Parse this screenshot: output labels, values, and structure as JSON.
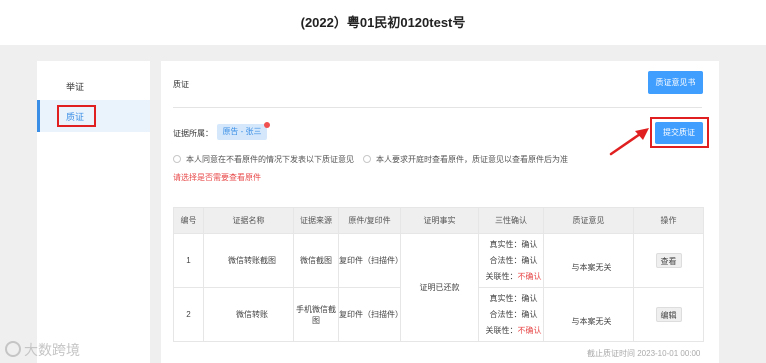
{
  "header": {
    "case_title": "(2022）粤01民初0120test号"
  },
  "sidebar": {
    "items": [
      {
        "label": "举证"
      },
      {
        "label": "质证"
      }
    ]
  },
  "main": {
    "section_title": "质证",
    "opinion_button": "质证意见书",
    "evidence_belong_label": "证据所属：",
    "evidence_belong_tag": "原告 - 张三",
    "submit_button": "提交质证",
    "radio_options": [
      "本人同意在不看原件的情况下发表以下质证意见",
      "本人要求开庭时查看原件，质证意见以查看原件后为准"
    ],
    "warning": "请选择是否需要查看原件",
    "table": {
      "headers": [
        "编号",
        "证据名称",
        "证据来源",
        "原件/复印件",
        "证明事实",
        "三性确认",
        "质证意见",
        "操作"
      ],
      "rows": [
        {
          "no": "1",
          "name": "微信转账截图",
          "source": "微信截图",
          "copy_type": "复印件（扫描件）",
          "authenticity_label": "真实性：",
          "authenticity": "确认",
          "legality_label": "合法性：",
          "legality": "确认",
          "relevance_label": "关联性：",
          "relevance": "不确认",
          "opinion": "与本案无关",
          "action": "查看"
        },
        {
          "no": "2",
          "name": "微信转账",
          "source": "手机微信截图",
          "copy_type": "复印件（扫描件）",
          "authenticity_label": "真实性：",
          "authenticity": "确认",
          "legality_label": "合法性：",
          "legality": "确认",
          "relevance_label": "关联性：",
          "relevance": "不确认",
          "opinion": "与本案无关",
          "action": "编辑"
        }
      ],
      "shared_fact": "证明已还款"
    },
    "deadline": "截止质证时间 2023-10-01 00:00"
  },
  "watermark": "大数跨境",
  "colors": {
    "accent": "#409eff",
    "annotation_red": "#e02020",
    "warning": "#e84a4a"
  }
}
